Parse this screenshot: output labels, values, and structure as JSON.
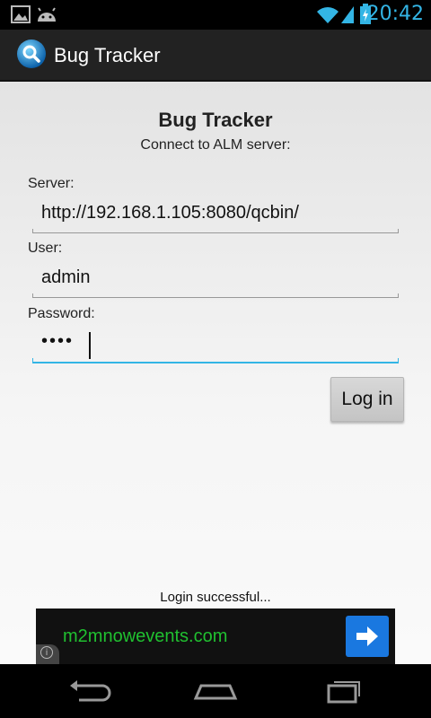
{
  "status_bar": {
    "time": "20:42",
    "icons": [
      "gallery-notification-icon",
      "android-notification-icon",
      "wifi-icon",
      "signal-icon",
      "battery-icon"
    ]
  },
  "action_bar": {
    "title": "Bug Tracker",
    "icon": "app-search-icon"
  },
  "form": {
    "title": "Bug Tracker",
    "subtitle": "Connect to ALM server:",
    "server_label": "Server:",
    "server_value": "http://192.168.1.105:8080/qcbin/",
    "user_label": "User:",
    "user_value": "admin",
    "password_label": "Password:",
    "password_value": "••••",
    "login_label": "Log in"
  },
  "status_message": "Login successful...",
  "ad": {
    "text": "m2mnowevents.com",
    "arrow_icon": "arrow-right-icon",
    "info_glyph": "i"
  },
  "nav_bar": {
    "icons": [
      "back-icon",
      "home-icon",
      "recent-apps-icon"
    ]
  },
  "colors": {
    "accent": "#33b5e5",
    "ad_text": "#20c030",
    "ad_button": "#1a78e0"
  }
}
